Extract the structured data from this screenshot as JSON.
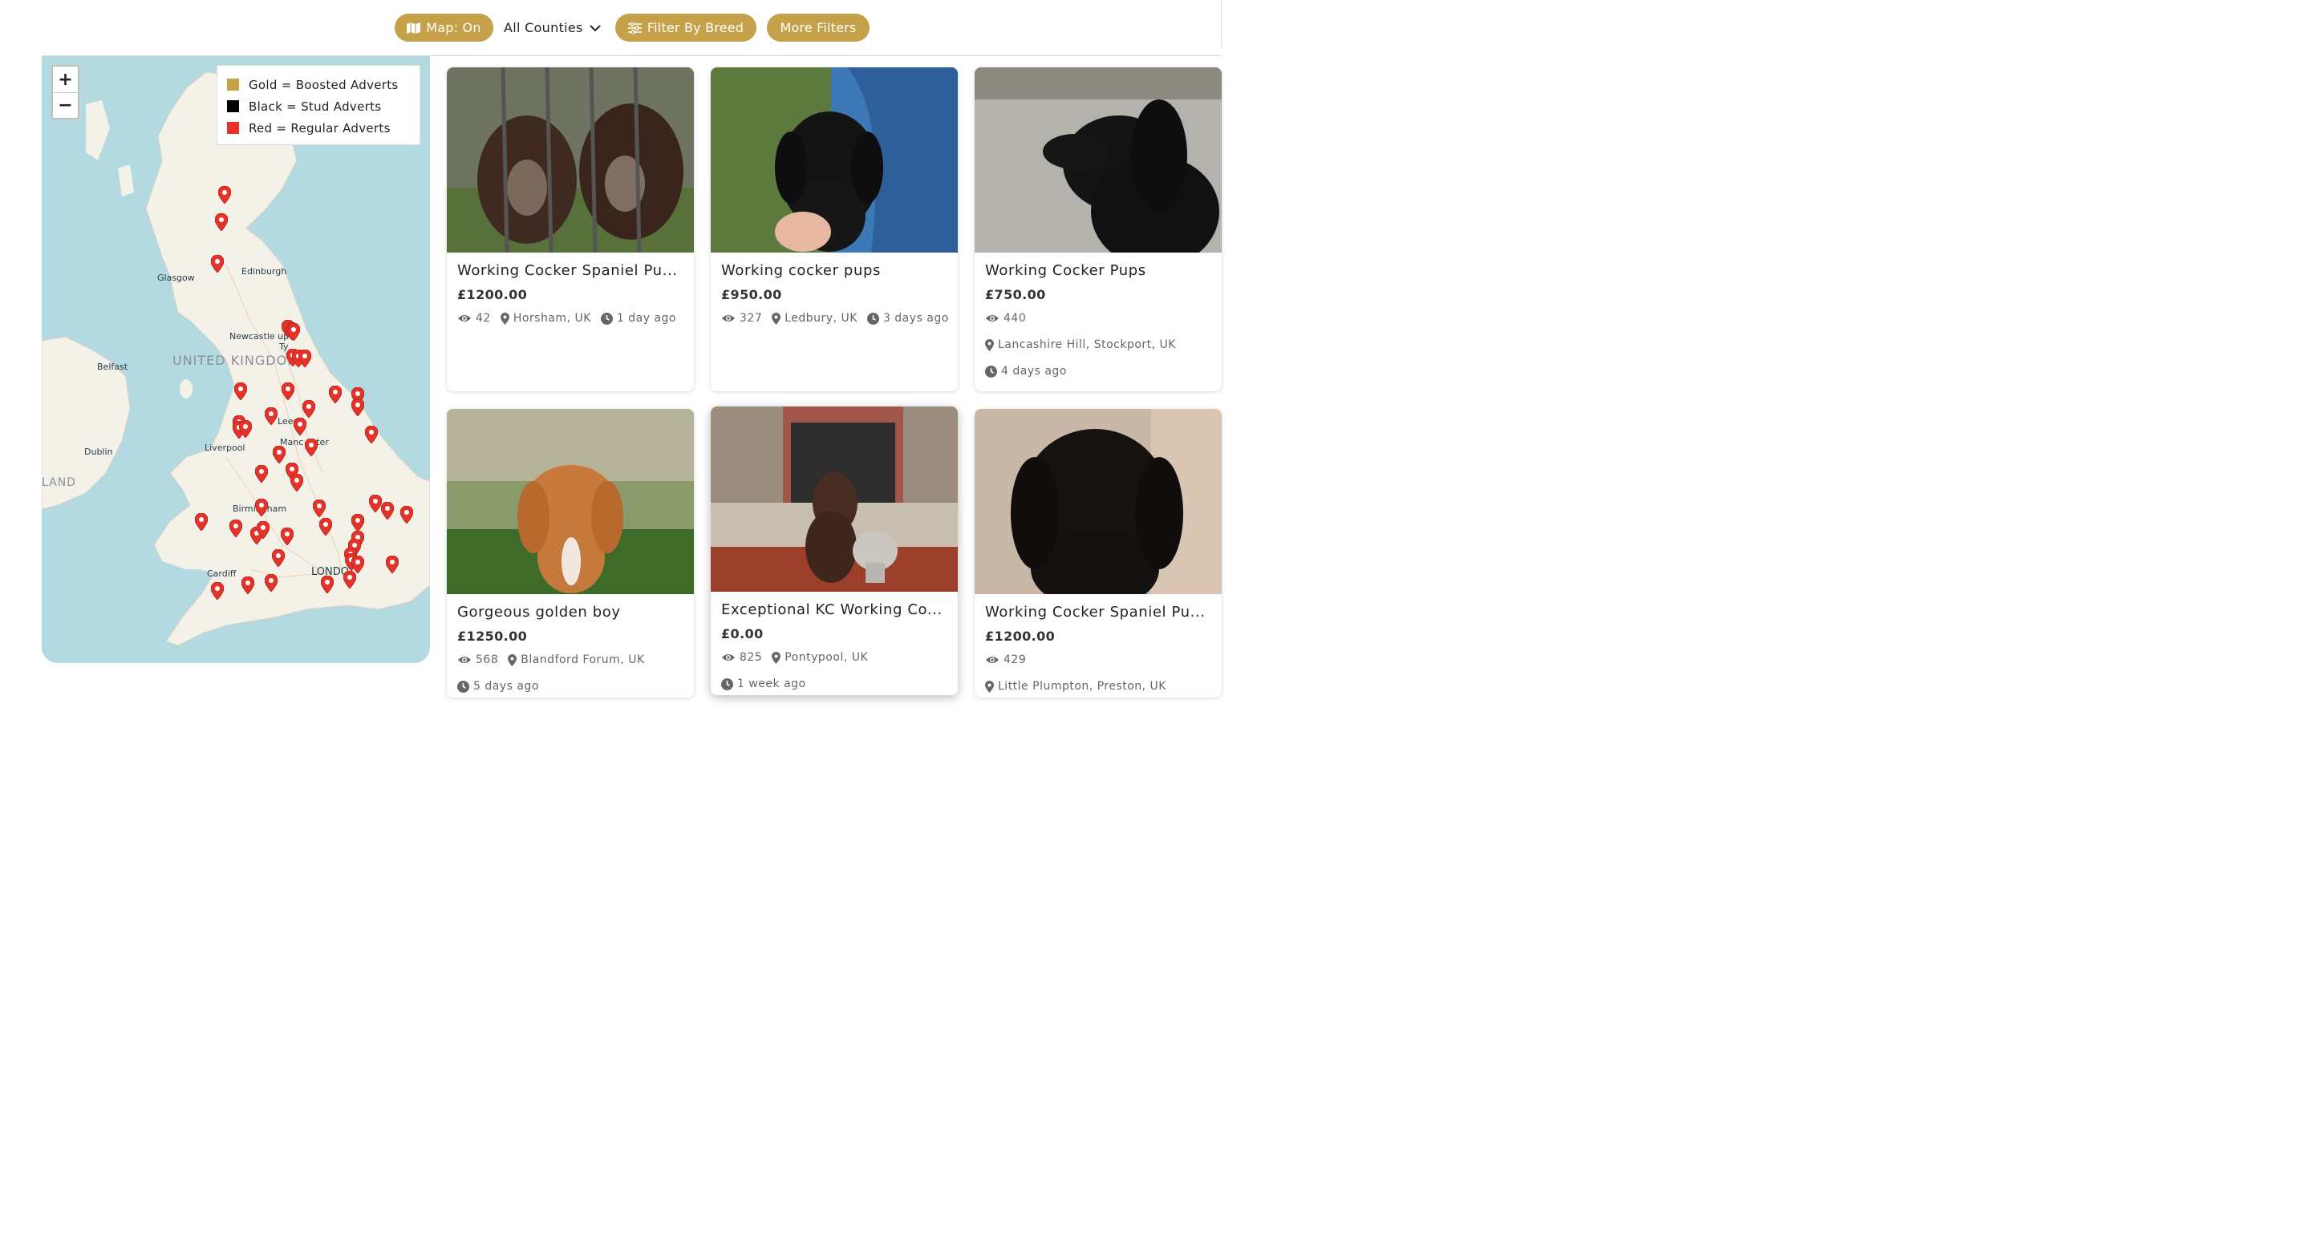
{
  "colors": {
    "accent": "#c5a24a",
    "pin": "#e5332a",
    "legend_gold": "#c5a24a",
    "legend_black": "#000000",
    "legend_red": "#e5332a"
  },
  "filters": {
    "map_toggle": {
      "label": "Map: On",
      "icon": "map-icon"
    },
    "counties": {
      "label": "All Counties",
      "icon": "chevron-down-icon"
    },
    "breed": {
      "label": "Filter By Breed",
      "icon": "sliders-icon"
    },
    "more": {
      "label": "More Filters"
    }
  },
  "map": {
    "zoom_in": "+",
    "zoom_out": "−",
    "legend": [
      {
        "label": "Gold = Boosted Adverts",
        "color": "#c5a24a"
      },
      {
        "label": "Black = Stud Adverts",
        "color": "#000000"
      },
      {
        "label": "Red = Regular Adverts",
        "color": "#e5332a"
      }
    ],
    "labels": {
      "glasgow": "Glasgow",
      "edinburgh": "Edinburgh",
      "newcastle": "Newcastle up",
      "newcastle2": "Ty",
      "uk": "UNITED KINGDOM",
      "belfast": "Belfast",
      "leeds": "Leeds",
      "manchester": "Manc     ester",
      "liverpool": "Liverpool",
      "dublin": "Dublin",
      "ireland": "LAND",
      "birmingham": "Birmingham",
      "cardiff": "Cardiff",
      "london": "LONDO"
    }
  },
  "listings": [
    {
      "title": "Working Cocker Spaniel Pu...",
      "price": "£1200.00",
      "views": "42",
      "location": "Horsham, UK",
      "time": "1 day ago"
    },
    {
      "title": "Working cocker pups",
      "price": "£950.00",
      "views": "327",
      "location": "Ledbury, UK",
      "time": "3 days ago"
    },
    {
      "title": "Working Cocker Pups",
      "price": "£750.00",
      "views": "440",
      "location": "Lancashire Hill, Stockport, UK",
      "time": "4 days ago"
    },
    {
      "title": "Gorgeous golden boy",
      "price": "£1250.00",
      "views": "568",
      "location": "Blandford Forum, UK",
      "time": "5 days ago"
    },
    {
      "title": "Exceptional KC Working Co...",
      "price": "£0.00",
      "views": "825",
      "location": "Pontypool, UK",
      "time": "1 week ago"
    },
    {
      "title": "Working Cocker Spaniel Pu...",
      "price": "£1200.00",
      "views": "429",
      "location": "Little Plumpton, Preston, UK",
      "time": ""
    }
  ]
}
